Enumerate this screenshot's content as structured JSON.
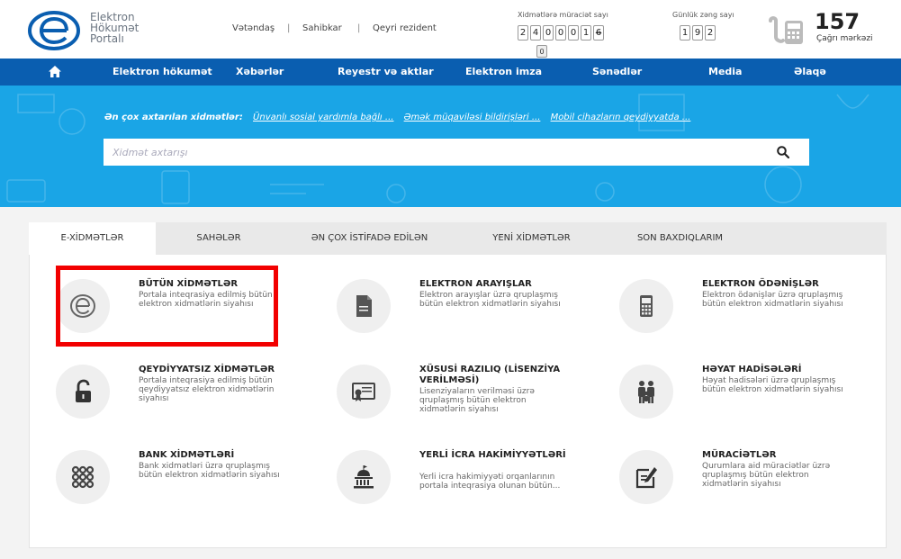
{
  "header": {
    "logo_lines": [
      "Elektron",
      "Hökumət",
      "Portalı"
    ],
    "audiences": [
      "Vətəndaş",
      "Sahibkar",
      "Qeyri rezident"
    ],
    "audience_separator": "|",
    "applications_label": "Xidmətlərə müraciət sayı",
    "applications_digits": [
      "2",
      "4",
      "0",
      "0",
      "0",
      "1",
      "6"
    ],
    "applications_overflow_digit": "0",
    "calls_label": "Günlük zəng sayı",
    "calls_digits": [
      "1",
      "9",
      "2"
    ],
    "call_center_number": "157",
    "call_center_label": "Çağrı mərkəzi",
    "phone_icon": "phone-keypad-icon"
  },
  "nav": {
    "home_icon": "home-icon",
    "items": [
      "Elektron hökumət",
      "Xəbərlər",
      "Reyestr və aktlar",
      "Elektron imza",
      "Sənədlər",
      "Media",
      "Əlaqə"
    ]
  },
  "hero": {
    "popular_label": "Ən çox axtarılan xidmətlər:",
    "popular_links": [
      "Ünvanlı sosial yardımla bağlı ...",
      "Əmək müqaviləsi bildirişləri ...",
      "Mobil cihazların qeydiyyatda ..."
    ],
    "search_placeholder": "Xidmət axtarışı",
    "search_icon": "search-icon"
  },
  "tabs": {
    "items": [
      "E-XİDMƏTLƏR",
      "SAHƏLƏR",
      "ƏN ÇOX İSTİFADƏ EDİLƏN",
      "YENİ XİDMƏTLƏR",
      "SON BAXDIQLARIM"
    ],
    "active": "E-XİDMƏTLƏR"
  },
  "tiles": [
    {
      "title": "BÜTÜN XİDMƏTLƏR",
      "desc": "Portala inteqrasiya edilmiş bütün elektron xidmətlərin siyahısı",
      "icon": "egov-logo-icon",
      "highlighted": true
    },
    {
      "title": "ELEKTRON ARAYIŞLAR",
      "desc": "Elektron arayışlar üzrə qruplaşmış bütün elektron xidmətlərin siyahısı",
      "icon": "document-icon"
    },
    {
      "title": "ELEKTRON ÖDƏNİŞLƏR",
      "desc": "Elektron ödənişlər üzrə qruplaşmış bütün elektron xidmətlərin siyahısı",
      "icon": "payment-terminal-icon"
    },
    {
      "title": "QEYDİYYATSIZ XİDMƏTLƏR",
      "desc": "Portala inteqrasiya edilmiş bütün qeydiyyatsız elektron xidmətlərin siyahısı",
      "icon": "unlock-icon"
    },
    {
      "title": "XÜSUSİ RAZILIQ (LİSENZİYA VERİLMƏSİ)",
      "desc": "Lisenziyaların verilməsi üzrə qruplaşmış bütün elektron xidmətlərin siyahısı",
      "icon": "certificate-icon"
    },
    {
      "title": "HƏYAT HADİSƏLƏRİ",
      "desc": "Həyat hadisələri üzrə qruplaşmış bütün elektron xidmətlərin siyahısı",
      "icon": "family-icon"
    },
    {
      "title": "BANK XİDMƏTLƏRİ",
      "desc": "Bank xidmətləri üzrə qruplaşmış bütün elektron xidmətlərin siyahısı",
      "icon": "grid-dots-icon"
    },
    {
      "title": "YERLİ İCRA HAKİMİYYƏTLƏRİ",
      "desc": "Yerli icra hakimiyyəti orqanlarının portala inteqrasiya olunan bütün...",
      "icon": "government-building-icon"
    },
    {
      "title": "MÜRACİƏTLƏR",
      "desc": "Qurumlara aid müraciətlər üzrə qruplaşmış bütün elektron xidmətlərin siyahısı",
      "icon": "edit-note-icon"
    }
  ],
  "colors": {
    "nav_bg": "#0a5eb0",
    "hero_bg": "#1aa5e6",
    "highlight_border": "#f20000"
  }
}
